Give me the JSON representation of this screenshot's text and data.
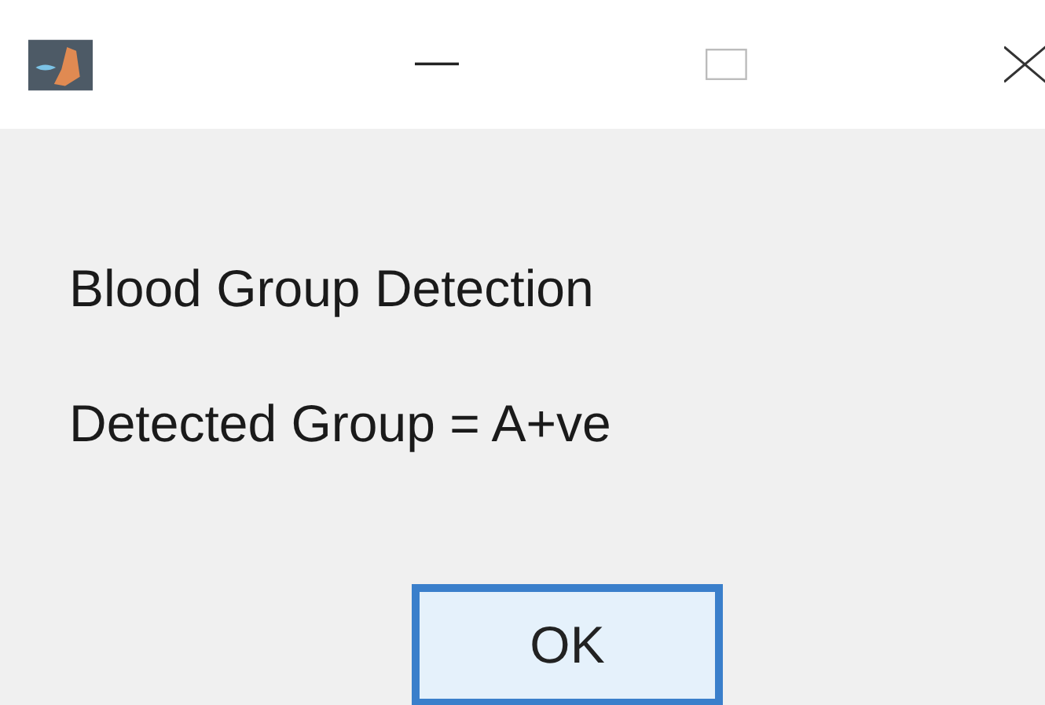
{
  "message_lines": [
    "Blood Group Detection",
    "Detected Group = A+ve"
  ],
  "buttons": [
    {
      "label": "OK",
      "focused": true
    }
  ]
}
